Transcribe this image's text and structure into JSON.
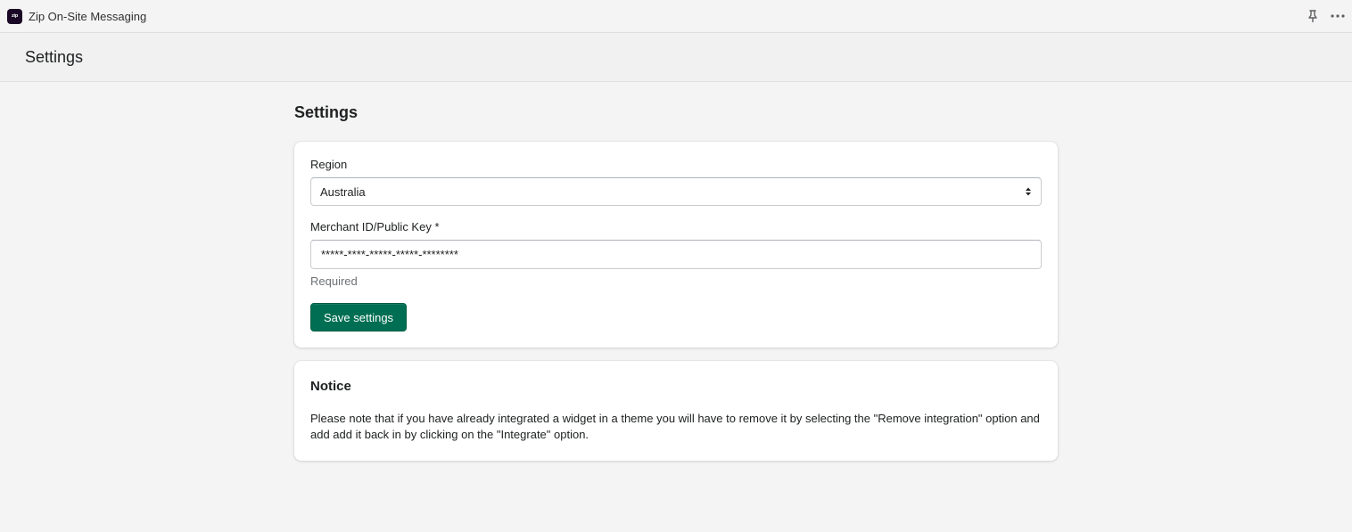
{
  "app_bar": {
    "logo_text": "zip",
    "title": "Zip On-Site Messaging",
    "icons": [
      "pin-icon",
      "more-icon"
    ]
  },
  "title_bar": {
    "title": "Settings"
  },
  "main": {
    "heading": "Settings",
    "settings_card": {
      "region_label": "Region",
      "region_value": "Australia",
      "merchant_label": "Merchant ID/Public Key *",
      "merchant_value": "*****-****-*****-*****-********",
      "merchant_help": "Required",
      "save_label": "Save settings"
    },
    "notice_card": {
      "title": "Notice",
      "text": "Please note that if you have already integrated a widget in a theme you will have to remove it by selecting the \"Remove integration\" option and add add it back in by clicking on the \"Integrate\" option."
    }
  },
  "colors": {
    "primary_button": "#006e52",
    "logo_bg": "#1a0826"
  }
}
